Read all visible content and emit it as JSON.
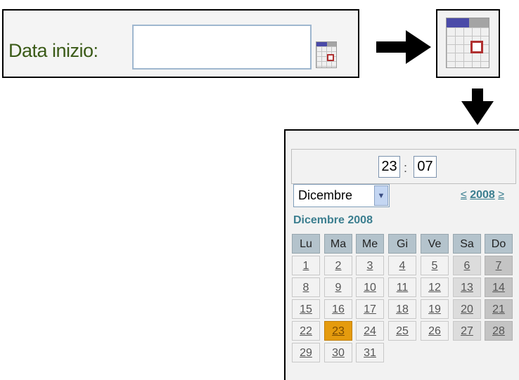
{
  "field": {
    "label": "Data inizio:",
    "value": "",
    "placeholder": ""
  },
  "icons": {
    "small": "calendar-icon",
    "large": "calendar-icon",
    "arrow_right": "arrow-right-icon",
    "arrow_down": "arrow-down-icon"
  },
  "colors": {
    "accent": "#3b7e8f",
    "label": "#3a5a17",
    "today": "#e59b0e",
    "header": "#b4c3cc"
  },
  "time": {
    "hour": "23",
    "separator": ":",
    "minute": "07"
  },
  "month_select": {
    "selected": "Dicembre",
    "button_glyph": "▼"
  },
  "year_nav": {
    "prev": "≤",
    "year": "2008",
    "next": "≥"
  },
  "calendar": {
    "title": "Dicembre 2008",
    "weekdays": [
      "Lu",
      "Ma",
      "Me",
      "Gi",
      "Ve",
      "Sa",
      "Do"
    ],
    "weeks": [
      [
        "1",
        "2",
        "3",
        "4",
        "5",
        "6",
        "7"
      ],
      [
        "8",
        "9",
        "10",
        "11",
        "12",
        "13",
        "14"
      ],
      [
        "15",
        "16",
        "17",
        "18",
        "19",
        "20",
        "21"
      ],
      [
        "22",
        "23",
        "24",
        "25",
        "26",
        "27",
        "28"
      ],
      [
        "29",
        "30",
        "31",
        "",
        "",
        "",
        ""
      ]
    ],
    "today": "23"
  }
}
